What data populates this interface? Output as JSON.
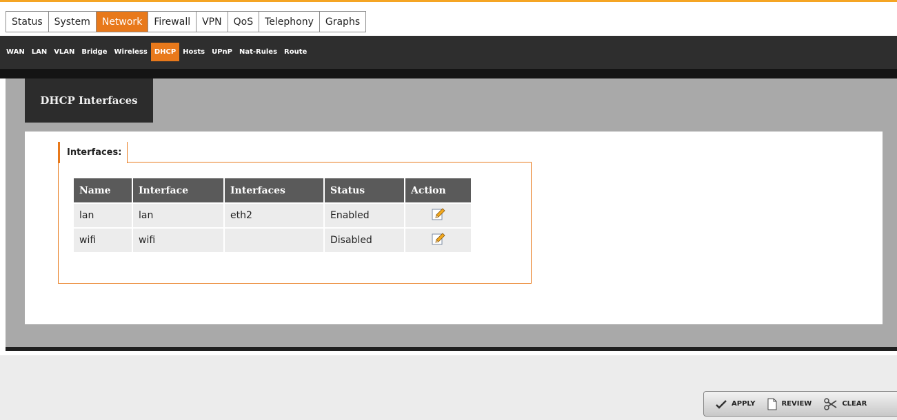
{
  "top_nav": {
    "items": [
      "Status",
      "System",
      "Network",
      "Firewall",
      "VPN",
      "QoS",
      "Telephony",
      "Graphs"
    ],
    "active": "Network"
  },
  "sub_nav": {
    "items": [
      "WAN",
      "LAN",
      "VLAN",
      "Bridge",
      "Wireless",
      "DHCP",
      "Hosts",
      "UPnP",
      "Nat-Rules",
      "Route"
    ],
    "active": "DHCP"
  },
  "panel": {
    "title": "DHCP Interfaces",
    "fieldset_legend": "Interfaces:"
  },
  "table": {
    "columns": [
      "Name",
      "Interface",
      "Interfaces",
      "Status",
      "Action"
    ],
    "rows": [
      {
        "name": "lan",
        "interface": "lan",
        "interfaces": "eth2",
        "status": "Enabled",
        "action_icon": "edit-icon"
      },
      {
        "name": "wifi",
        "interface": "wifi",
        "interfaces": "",
        "status": "Disabled",
        "action_icon": "edit-icon"
      }
    ]
  },
  "footer": {
    "apply_label": "APPLY",
    "review_label": "REVIEW",
    "clear_label": "CLEAR"
  },
  "colors": {
    "accent": "#e8791b",
    "top_border": "#f5a524",
    "dark_bar": "#2e2e2e",
    "panel_gray": "#a9a9a9",
    "table_header": "#5a5a5a"
  }
}
